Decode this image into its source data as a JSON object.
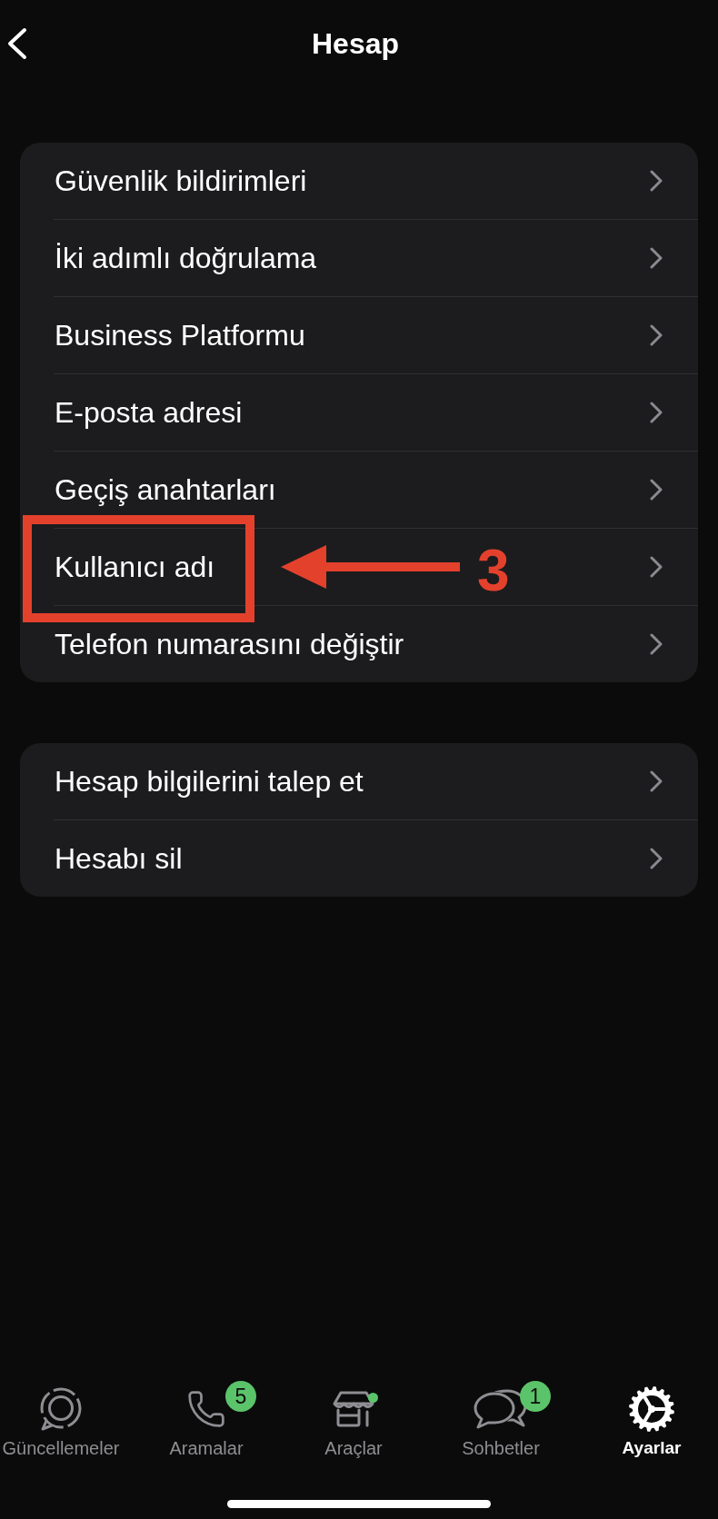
{
  "header": {
    "title": "Hesap"
  },
  "groups": [
    {
      "rows": [
        {
          "label": "Güvenlik bildirimleri",
          "highlighted": false
        },
        {
          "label": "İki adımlı doğrulama",
          "highlighted": false
        },
        {
          "label": "Business Platformu",
          "highlighted": false
        },
        {
          "label": "E-posta adresi",
          "highlighted": false
        },
        {
          "label": "Geçiş anahtarları",
          "highlighted": false
        },
        {
          "label": "Kullanıcı adı",
          "highlighted": true,
          "callout": "3"
        },
        {
          "label": "Telefon numarasını değiştir",
          "highlighted": false
        }
      ]
    },
    {
      "rows": [
        {
          "label": "Hesap bilgilerini talep et",
          "highlighted": false
        },
        {
          "label": "Hesabı sil",
          "highlighted": false
        }
      ]
    }
  ],
  "tab_bar": {
    "tabs": [
      {
        "label": "Güncellemeler",
        "selected": false,
        "dot": false
      },
      {
        "label": "Aramalar",
        "selected": false,
        "dot": false,
        "badge": "5"
      },
      {
        "label": "Araçlar",
        "selected": false,
        "dot": true
      },
      {
        "label": "Sohbetler",
        "selected": false,
        "dot": false,
        "badge": "1"
      },
      {
        "label": "Ayarlar",
        "selected": true,
        "dot": false
      }
    ]
  }
}
